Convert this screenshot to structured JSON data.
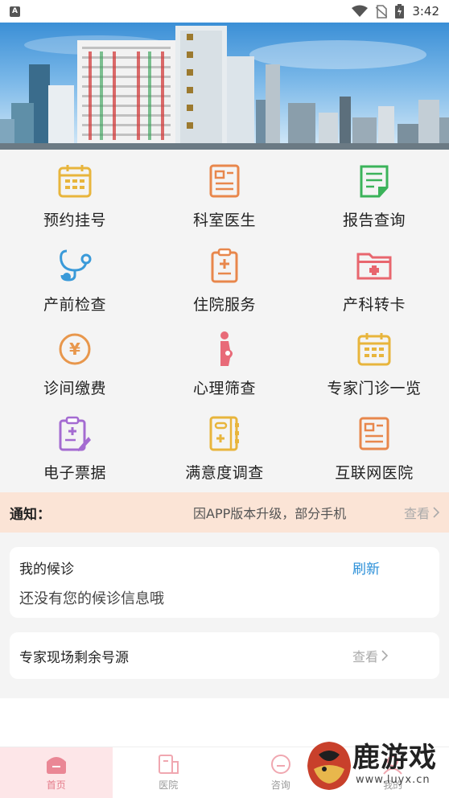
{
  "status_bar": {
    "app_badge": "A",
    "time": "3:42"
  },
  "menu": [
    {
      "label": "预约挂号",
      "icon": "calendar-icon",
      "color": "#e8b53c"
    },
    {
      "label": "科室医生",
      "icon": "doctor-card-icon",
      "color": "#e8874c"
    },
    {
      "label": "报告查询",
      "icon": "report-icon",
      "color": "#3bb35a"
    },
    {
      "label": "产前检查",
      "icon": "stethoscope-icon",
      "color": "#3a9ad9"
    },
    {
      "label": "住院服务",
      "icon": "clipboard-plus-icon",
      "color": "#e8874c"
    },
    {
      "label": "产科转卡",
      "icon": "medical-folder-icon",
      "color": "#e8666e"
    },
    {
      "label": "诊间缴费",
      "icon": "yuan-coin-icon",
      "color": "#e8974c"
    },
    {
      "label": "心理筛查",
      "icon": "pregnant-woman-icon",
      "color": "#e86a78"
    },
    {
      "label": "专家门诊一览",
      "icon": "calendar-icon",
      "color": "#e8b53c"
    },
    {
      "label": "电子票据",
      "icon": "receipt-icon",
      "color": "#a46bd1"
    },
    {
      "label": "满意度调查",
      "icon": "survey-book-icon",
      "color": "#e8b53c"
    },
    {
      "label": "互联网医院",
      "icon": "internet-hospital-icon",
      "color": "#e8874c"
    }
  ],
  "notice": {
    "title": "通知：",
    "text": "因APP版本升级，部分手机",
    "more": "查看"
  },
  "queue_card": {
    "title": "我的候诊",
    "refresh": "刷新",
    "empty": "还没有您的候诊信息哦"
  },
  "slots_card": {
    "title": "专家现场剩余号源",
    "more": "查看"
  },
  "bottom_nav": [
    {
      "label": "首页",
      "icon": "home-icon",
      "active": true
    },
    {
      "label": "医院",
      "icon": "hospital-icon",
      "active": false
    },
    {
      "label": "咨询",
      "icon": "chat-icon",
      "active": false
    },
    {
      "label": "我的",
      "icon": "profile-icon",
      "active": false
    }
  ],
  "watermark": {
    "text": "鹿游戏",
    "url": "www.luyx.cn"
  },
  "colors": {
    "accent_blue": "#2a8fd8",
    "notice_bg": "#fbe4d6",
    "nav_active": "#e47b8a"
  }
}
